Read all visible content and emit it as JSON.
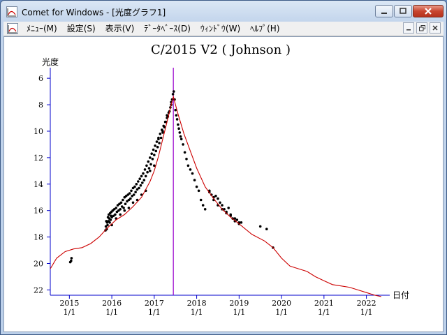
{
  "window": {
    "title": "Comet for Windows - [光度グラフ1]",
    "app_icon": "chart-icon"
  },
  "menubar": {
    "items": [
      {
        "label": "ﾒﾆｭｰ(M)"
      },
      {
        "label": "設定(S)"
      },
      {
        "label": "表示(V)"
      },
      {
        "label": "ﾃﾞｰﾀﾍﾞｰｽ(D)"
      },
      {
        "label": "ｳｨﾝﾄﾞｳ(W)"
      },
      {
        "label": "ﾍﾙﾌﾟ(H)"
      }
    ]
  },
  "colors": {
    "axis": "#0000cc",
    "model_curve": "#cc0000",
    "perihelion_line": "#9900cc",
    "observations": "#000000"
  },
  "chart_data": {
    "type": "scatter",
    "title": "C/2015 V2 ( Johnson )",
    "ylabel": "光度",
    "xlabel": "日付",
    "ylim": [
      22.4,
      5.2
    ],
    "y_inverted": true,
    "y_ticks": [
      "6",
      "8",
      "10",
      "12",
      "14",
      "16",
      "18",
      "20",
      "22"
    ],
    "xlim": [
      2014.55,
      2022.55
    ],
    "x_ticks": [
      {
        "year": "2015",
        "date": "1/1"
      },
      {
        "year": "2016",
        "date": "1/1"
      },
      {
        "year": "2017",
        "date": "1/1"
      },
      {
        "year": "2018",
        "date": "1/1"
      },
      {
        "year": "2019",
        "date": "1/1"
      },
      {
        "year": "2020",
        "date": "1/1"
      },
      {
        "year": "2021",
        "date": "1/1"
      },
      {
        "year": "2022",
        "date": "1/1"
      }
    ],
    "perihelion_x": 2017.45,
    "model_curve": {
      "name": "",
      "x": [
        2014.55,
        2014.7,
        2014.9,
        2015.1,
        2015.3,
        2015.5,
        2015.7,
        2015.9,
        2016.1,
        2016.3,
        2016.5,
        2016.7,
        2016.9,
        2017.0,
        2017.1,
        2017.2,
        2017.3,
        2017.4,
        2017.45,
        2017.55,
        2017.7,
        2017.85,
        2018.0,
        2018.2,
        2018.4,
        2018.6,
        2018.8,
        2019.0,
        2019.3,
        2019.6,
        2019.8,
        2020.0,
        2020.2,
        2020.4,
        2020.6,
        2020.8,
        2021.0,
        2021.2,
        2021.4,
        2021.6,
        2021.8,
        2022.0,
        2022.2,
        2022.35
      ],
      "y": [
        20.4,
        19.6,
        19.1,
        18.9,
        18.8,
        18.5,
        18.0,
        17.3,
        16.7,
        16.3,
        15.7,
        15.0,
        13.8,
        13.0,
        11.9,
        10.6,
        9.3,
        8.0,
        7.4,
        8.6,
        10.2,
        11.5,
        12.8,
        14.2,
        15.1,
        15.9,
        16.5,
        17.0,
        17.8,
        18.3,
        18.8,
        19.6,
        20.2,
        20.4,
        20.6,
        21.0,
        21.3,
        21.6,
        21.7,
        21.8,
        22.0,
        22.2,
        22.4,
        22.5
      ]
    },
    "observations": {
      "x": [
        2015.02,
        2015.05,
        2015.04,
        2015.85,
        2015.86,
        2015.87,
        2015.88,
        2015.89,
        2015.9,
        2015.91,
        2015.92,
        2015.93,
        2015.94,
        2015.95,
        2015.96,
        2015.97,
        2015.98,
        2015.99,
        2016.0,
        2016.02,
        2016.04,
        2016.06,
        2016.08,
        2016.1,
        2016.12,
        2016.14,
        2016.16,
        2016.18,
        2016.2,
        2016.22,
        2016.24,
        2016.26,
        2016.28,
        2016.3,
        2016.32,
        2016.34,
        2016.36,
        2016.38,
        2016.4,
        2016.42,
        2016.44,
        2016.46,
        2016.48,
        2016.5,
        2016.52,
        2016.54,
        2016.56,
        2016.58,
        2016.6,
        2016.62,
        2016.64,
        2016.66,
        2016.68,
        2016.7,
        2016.72,
        2016.74,
        2016.76,
        2016.78,
        2016.8,
        2016.82,
        2016.84,
        2016.86,
        2016.88,
        2016.9,
        2016.92,
        2016.94,
        2016.96,
        2016.98,
        2017.0,
        2017.02,
        2017.04,
        2017.06,
        2017.08,
        2017.1,
        2017.12,
        2017.14,
        2017.16,
        2017.18,
        2017.2,
        2017.22,
        2017.24,
        2017.26,
        2017.28,
        2017.3,
        2017.32,
        2017.34,
        2017.36,
        2017.38,
        2017.4,
        2017.42,
        2017.44,
        2017.46,
        2017.48,
        2017.5,
        2017.52,
        2017.54,
        2017.56,
        2017.58,
        2017.6,
        2017.62,
        2017.64,
        2017.68,
        2017.72,
        2017.76,
        2017.8,
        2017.85,
        2017.9,
        2017.95,
        2018.0,
        2018.05,
        2018.1,
        2018.15,
        2018.2,
        2018.3,
        2018.35,
        2018.4,
        2018.45,
        2018.5,
        2018.55,
        2018.6,
        2018.65,
        2018.7,
        2018.75,
        2018.8,
        2018.85,
        2018.9,
        2018.95,
        2019.0,
        2019.05,
        2018.3,
        2018.4,
        2018.5,
        2018.6,
        2018.7,
        2018.8,
        2018.9,
        2019.0,
        2019.5,
        2019.65,
        2019.8,
        2016.1,
        2016.3,
        2016.5,
        2016.7,
        2016.9,
        2017.1,
        2017.3,
        2016.0,
        2016.2,
        2016.4,
        2016.6,
        2016.8,
        2017.0,
        2017.2,
        2017.4
      ],
      "y": [
        19.9,
        19.6,
        19.8,
        17.5,
        17.2,
        16.8,
        17.4,
        16.9,
        17.1,
        16.5,
        16.8,
        16.3,
        16.6,
        16.9,
        16.2,
        16.7,
        16.4,
        16.1,
        16.5,
        16.0,
        16.4,
        15.9,
        16.3,
        15.8,
        16.1,
        15.6,
        16.0,
        15.5,
        15.9,
        15.4,
        15.7,
        15.2,
        15.8,
        15.0,
        15.5,
        14.9,
        15.3,
        14.8,
        15.2,
        14.7,
        15.1,
        14.5,
        14.9,
        14.3,
        14.8,
        14.2,
        14.6,
        14.0,
        14.4,
        13.8,
        14.3,
        13.6,
        14.1,
        13.4,
        13.9,
        13.2,
        13.7,
        12.9,
        13.4,
        12.6,
        13.1,
        12.3,
        12.8,
        12.0,
        12.5,
        11.7,
        12.1,
        11.4,
        11.8,
        11.1,
        11.5,
        10.8,
        11.2,
        10.5,
        10.9,
        10.2,
        10.5,
        9.9,
        10.1,
        9.6,
        9.7,
        9.3,
        9.3,
        9.0,
        8.9,
        8.6,
        8.5,
        8.2,
        8.0,
        7.6,
        7.2,
        7.0,
        7.6,
        8.4,
        8.8,
        9.1,
        9.5,
        9.8,
        10.1,
        10.4,
        10.6,
        11.0,
        11.6,
        12.1,
        12.6,
        12.9,
        13.2,
        13.7,
        14.2,
        14.5,
        15.2,
        15.6,
        15.9,
        14.5,
        14.8,
        15.0,
        14.9,
        15.1,
        15.4,
        15.6,
        15.9,
        16.1,
        15.8,
        16.3,
        16.6,
        16.8,
        16.7,
        17.0,
        16.9,
        14.6,
        15.2,
        15.6,
        15.9,
        16.2,
        16.4,
        16.6,
        16.9,
        17.2,
        17.4,
        18.8,
        16.6,
        16.0,
        15.4,
        14.8,
        13.0,
        10.6,
        8.8,
        17.1,
        16.3,
        15.8,
        15.2,
        14.5,
        12.6,
        10.0,
        7.8
      ]
    }
  }
}
